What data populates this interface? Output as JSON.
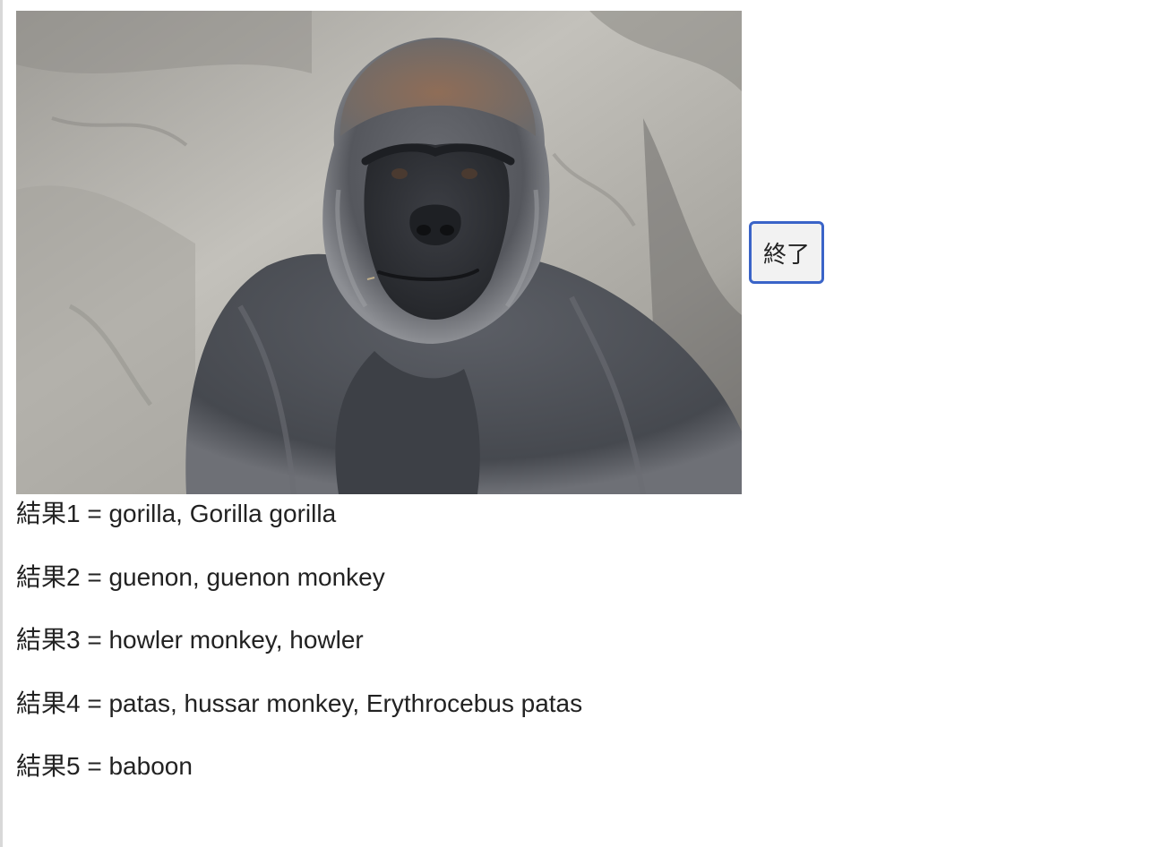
{
  "photo": {
    "subject": "gorilla photo",
    "colors": {
      "rock_light": "#b9b7b1",
      "rock_dark": "#8a8883",
      "fur": "#4f5258",
      "fur_dark": "#2c2e33",
      "crest": "#8a6a55"
    }
  },
  "buttons": {
    "end_label": "終了",
    "border_color": "#3a64c8"
  },
  "results": [
    "結果1 = gorilla, Gorilla gorilla",
    "結果2 = guenon, guenon monkey",
    "結果3 = howler monkey, howler",
    "結果4 = patas, hussar monkey, Erythrocebus patas",
    "結果5 = baboon"
  ]
}
